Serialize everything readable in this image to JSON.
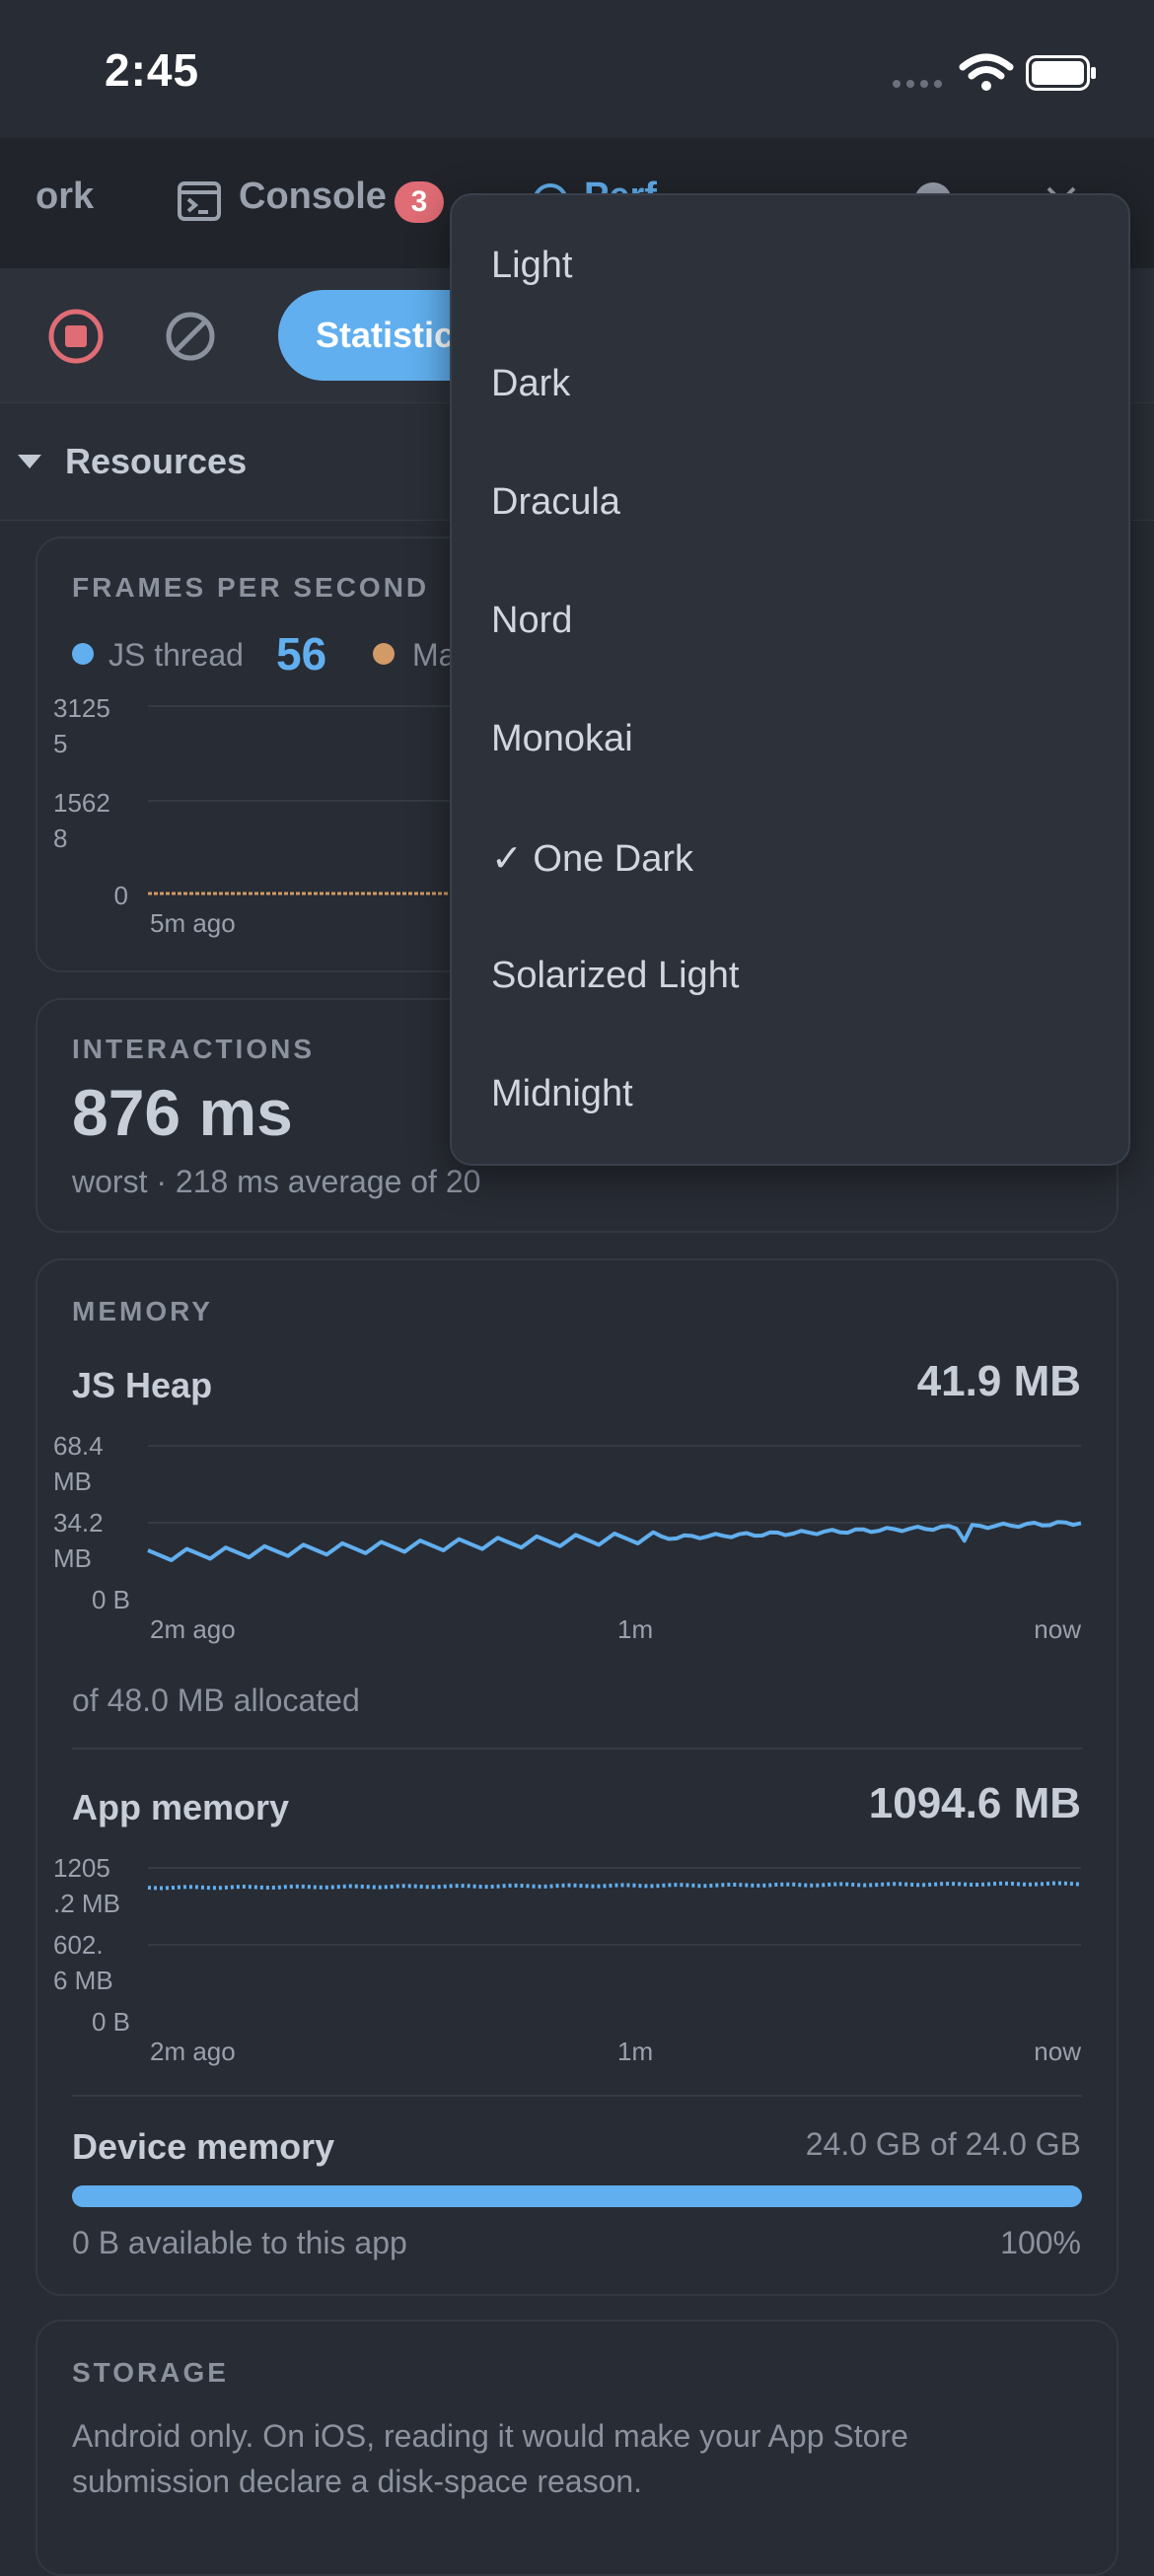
{
  "status": {
    "time": "2:45"
  },
  "tabs": {
    "network": "ork",
    "console": "Console",
    "console_badge": "3",
    "performance": "Perf"
  },
  "toolbar": {
    "active_tab": "Statistics"
  },
  "resources": {
    "title": "Resources"
  },
  "fps": {
    "label": "FRAMES PER SECOND",
    "js_label": "JS thread",
    "js_value": "56",
    "main_label": "Ma",
    "y_ticks": [
      "3125\n5",
      "1562\n8",
      "0"
    ],
    "x_start": "5m ago"
  },
  "interactions": {
    "label": "INTERACTIONS",
    "value": "876 ms",
    "sub": "worst · 218 ms average of 20"
  },
  "memory": {
    "label": "MEMORY",
    "js_heap": {
      "title": "JS Heap",
      "value": "41.9 MB",
      "y_ticks": [
        "68.4\nMB",
        "34.2\nMB",
        "0 B"
      ],
      "x_ticks": [
        "2m ago",
        "1m",
        "now"
      ],
      "allocated": "of 48.0 MB allocated"
    },
    "app_memory": {
      "title": "App memory",
      "value": "1094.6 MB",
      "y_ticks": [
        "1205\n.2 MB",
        "602.\n6 MB",
        "0 B"
      ],
      "x_ticks": [
        "2m ago",
        "1m",
        "now"
      ]
    },
    "device": {
      "title": "Device memory",
      "value": "24.0 GB of 24.0 GB",
      "available": "0 B available to this app",
      "percent_label": "100%",
      "fill": 1.0
    }
  },
  "storage": {
    "label": "STORAGE",
    "text1": "Android only. On iOS, reading it would make your App Store",
    "text2": "submission declare a disk-space reason."
  },
  "theme_menu": {
    "items": [
      "Light",
      "Dark",
      "Dracula",
      "Nord",
      "Monokai",
      "✓ One Dark",
      "Solarized Light",
      "Midnight"
    ],
    "selected": "One Dark"
  },
  "colors": {
    "accent": "#61afef",
    "orange": "#d19a66",
    "danger": "#e06c75"
  }
}
